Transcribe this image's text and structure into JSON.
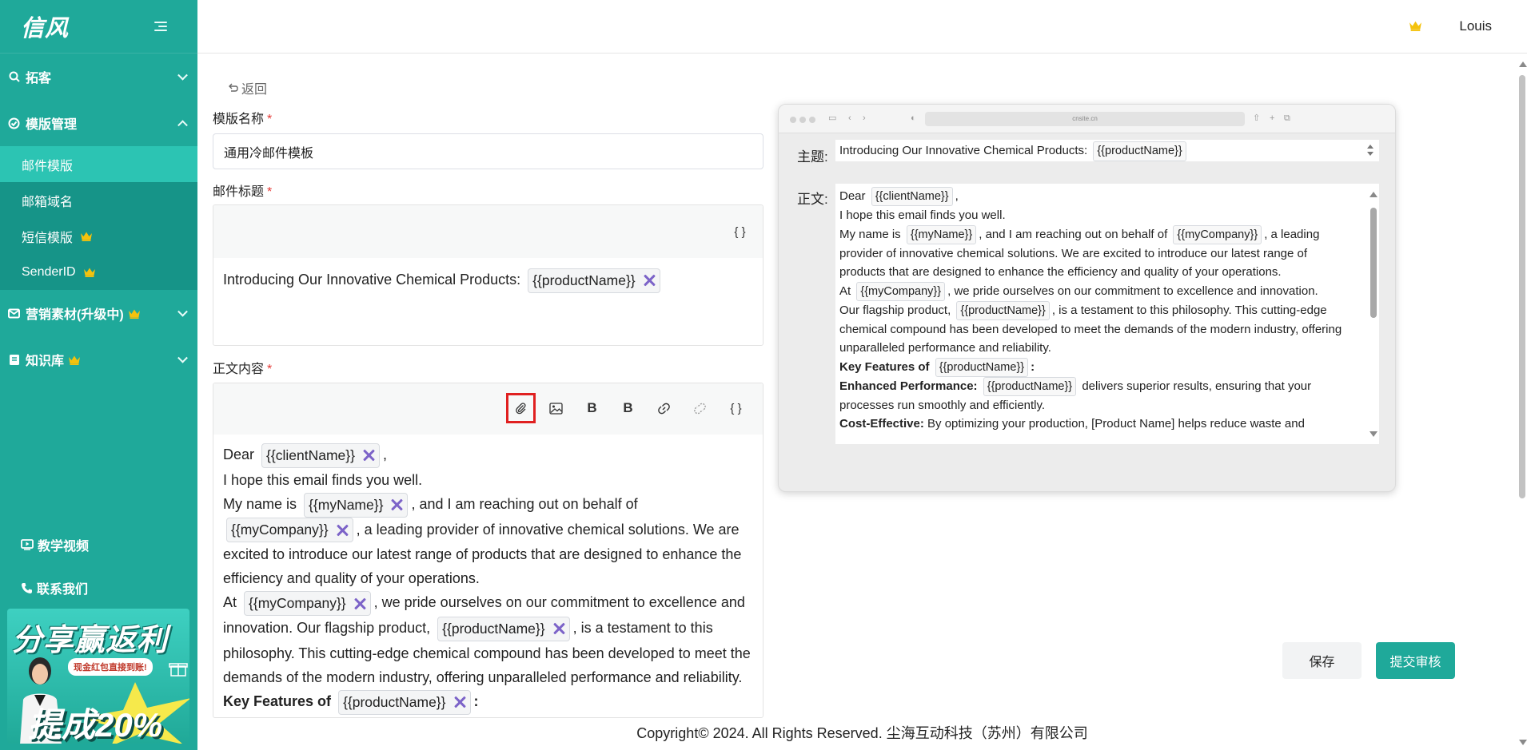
{
  "app": {
    "logo": "信风"
  },
  "sidebar": {
    "groups": [
      {
        "label": "拓客",
        "expanded": false,
        "icon": "search-icon"
      },
      {
        "label": "模版管理",
        "expanded": true,
        "icon": "template-icon",
        "items": [
          {
            "label": "邮件模版",
            "active": true
          },
          {
            "label": "邮箱域名"
          },
          {
            "label": "短信模版",
            "premium": true
          },
          {
            "label": "SenderID",
            "premium": true
          }
        ]
      },
      {
        "label": "营销素材(升级中)",
        "premium": true,
        "expanded": false,
        "icon": "mail-icon"
      },
      {
        "label": "知识库",
        "premium": true,
        "expanded": false,
        "icon": "book-icon"
      }
    ],
    "bottom_links": [
      {
        "label": "教学视频",
        "icon": "video-icon"
      },
      {
        "label": "联系我们",
        "icon": "phone-icon"
      }
    ],
    "promo": {
      "title": "分享赢返利",
      "subtitle": "现金红包直接到账!",
      "highlight": "提成20%"
    }
  },
  "header": {
    "user_name": "Louis",
    "icon": "crown-icon"
  },
  "page": {
    "back_label": "返回",
    "template_name_label": "模版名称",
    "template_name_value": "通用冷邮件模板",
    "email_subject_label": "邮件标题",
    "body_label": "正文内容",
    "required_mark": "*"
  },
  "subject_editor": {
    "toolbar_braces": "{ }",
    "text": "Introducing Our Innovative Chemical Products:",
    "tag": "{{productName}}"
  },
  "body_editor": {
    "toolbar": [
      {
        "name": "attachment-icon",
        "selected": true
      },
      {
        "name": "image-icon"
      },
      {
        "name": "bold-icon",
        "label": "B"
      },
      {
        "name": "bold-alt-icon",
        "label": "B"
      },
      {
        "name": "link-icon"
      },
      {
        "name": "unlink-icon"
      },
      {
        "name": "braces-icon",
        "label": "{ }"
      }
    ],
    "line1_pre": "Dear",
    "tag_client": "{{clientName}}",
    "line1_post": ",",
    "line2": "I hope this email finds you well.",
    "line3_pre": "My name is",
    "tag_myname": "{{myName}}",
    "line3_mid": ", and I am reaching out on behalf of",
    "tag_mycompany": "{{myCompany}}",
    "line3_post": ", a leading provider of innovative chemical solutions. We are excited to introduce our latest range of products that are designed to enhance the efficiency and quality of your operations.",
    "line4_pre": "At",
    "line4_post": ", we pride ourselves on our commitment to excellence and innovation. Our flagship product,",
    "tag_product": "{{productName}}",
    "line4_end": ", is a testament to this philosophy. This cutting-edge chemical compound has been developed to meet the demands of the modern industry, offering unparalleled performance and reliability.",
    "features_pre": "Key Features of",
    "features_post": ":"
  },
  "preview": {
    "url": "cnsite.cn",
    "subject_label": "主题:",
    "subject_text": "Introducing Our Innovative Chemical Products:",
    "subject_tag": "{{productName}}",
    "body_label": "正文:",
    "dear": "Dear",
    "tag_client": "{{clientName}}",
    "comma": ",",
    "hope": "I hope this email finds you well.",
    "myname_pre": "My name is",
    "tag_myname": "{{myName}}",
    "myname_mid": ", and I am reaching out on behalf of",
    "tag_mycompany": "{{myCompany}}",
    "myname_post": ", a leading provider of innovative chemical solutions. We are excited to introduce our latest range of products that are designed to enhance the efficiency and quality of your operations.",
    "at_pre": "At",
    "at_post": ", we pride ourselves on our commitment to excellence and innovation.",
    "flagship_pre": "Our flagship product,",
    "tag_product": "{{productName}}",
    "flagship_post": ", is a testament to this philosophy. This cutting-edge chemical compound has been developed to meet the demands of the modern industry, offering unparalleled performance and reliability.",
    "features_pre": "Key Features of",
    "features_post": ":",
    "enhanced_label": "Enhanced Performance:",
    "enhanced_post": "delivers superior results, ensuring that your processes run smoothly and efficiently.",
    "cost_label": "Cost-Effective:",
    "cost_post": "By optimizing your production, [Product Name] helps reduce waste and"
  },
  "actions": {
    "save": "保存",
    "submit": "提交审核"
  },
  "footer": {
    "copyright": "Copyright© 2024. All Rights Reserved. 尘海互动科技（苏州）有限公司"
  },
  "colors": {
    "brand": "#1fa99a",
    "active_item": "#2cc4b3",
    "required": "#e53935",
    "tag_close": "#7c63c8",
    "crown": "#f4c20d"
  }
}
